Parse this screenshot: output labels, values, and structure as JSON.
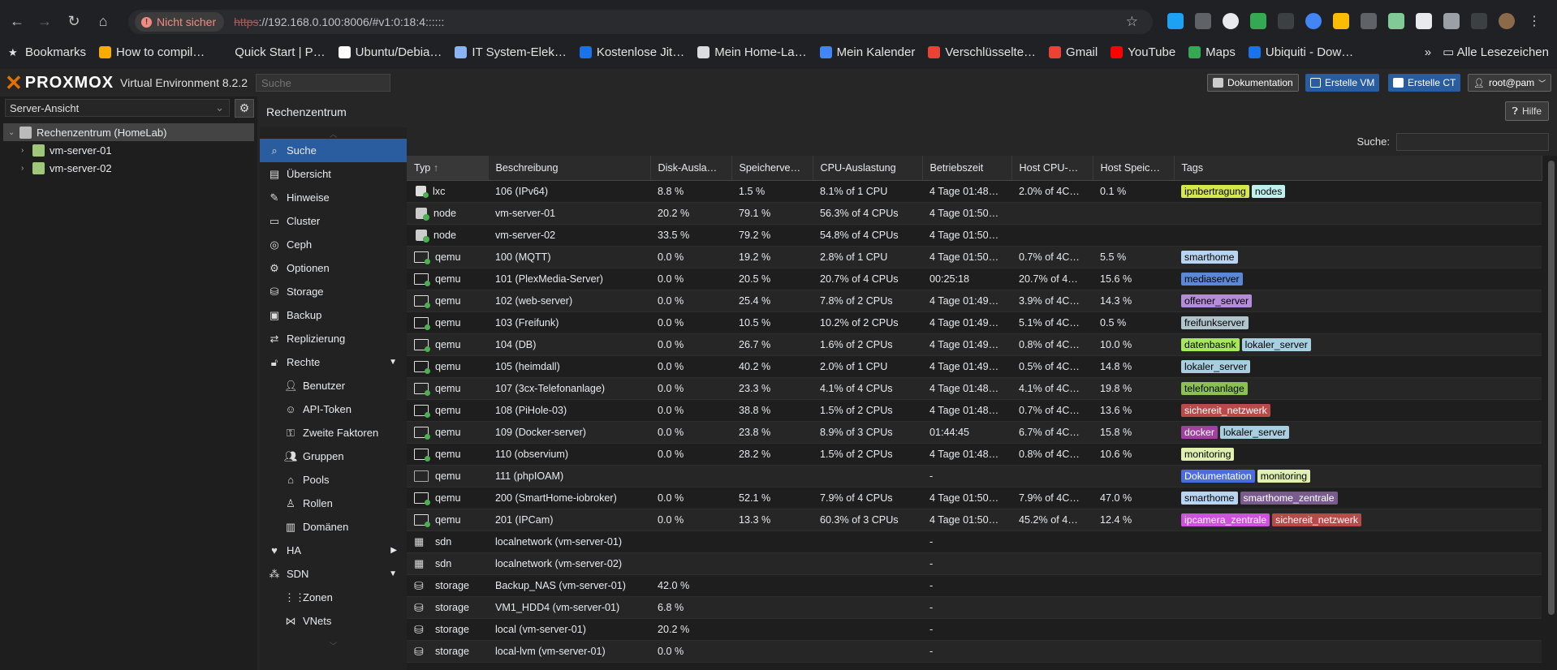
{
  "browser": {
    "not_secure_label": "Nicht sicher",
    "url_scheme": "https",
    "url_rest": "://192.168.0.100:8006/#v1:0:18:4::::::",
    "bookmarks": [
      {
        "label": "Bookmarks",
        "color": "#e3e3e3",
        "icon": "star-icon"
      },
      {
        "label": "How to compil…",
        "color": "#f9ab00",
        "icon": "bookmark-favicon"
      },
      {
        "label": "Quick Start | P…",
        "color": "#202124",
        "icon": "bookmark-favicon"
      },
      {
        "label": "Ubuntu/Debia…",
        "color": "#ffffff",
        "icon": "bookmark-favicon"
      },
      {
        "label": "IT System-Elek…",
        "color": "#8ab4f8",
        "icon": "bookmark-favicon"
      },
      {
        "label": "Kostenlose Jit…",
        "color": "#1a73e8",
        "icon": "bookmark-favicon"
      },
      {
        "label": "Mein Home-La…",
        "color": "#dadce0",
        "icon": "wordpress-icon"
      },
      {
        "label": "Mein Kalender",
        "color": "#4285f4",
        "icon": "calendar-icon"
      },
      {
        "label": "Verschlüsselte…",
        "color": "#ea4335",
        "icon": "bookmark-favicon"
      },
      {
        "label": "Gmail",
        "color": "#ea4335",
        "icon": "gmail-icon"
      },
      {
        "label": "YouTube",
        "color": "#ff0000",
        "icon": "youtube-icon"
      },
      {
        "label": "Maps",
        "color": "#34a853",
        "icon": "maps-icon"
      },
      {
        "label": "Ubiquiti - Dow…",
        "color": "#1a73e8",
        "icon": "bookmark-favicon"
      }
    ],
    "all_bookmarks_label": "Alle Lesezeichen"
  },
  "header": {
    "logo": "PROXMOX",
    "product": "Virtual Environment 8.2.2",
    "search_placeholder": "Suche",
    "btn_docs": "Dokumentation",
    "btn_create_vm": "Erstelle VM",
    "btn_create_ct": "Erstelle CT",
    "user": "root@pam"
  },
  "left": {
    "view_select": "Server-Ansicht",
    "tree": [
      {
        "label": "Rechenzentrum (HomeLab)",
        "level": 0
      },
      {
        "label": "vm-server-01",
        "level": 1
      },
      {
        "label": "vm-server-02",
        "level": 1
      }
    ]
  },
  "center": {
    "title": "Rechenzentrum",
    "help": "Hilfe",
    "search_label": "Suche:",
    "menu": [
      {
        "label": "Suche",
        "icon": "search-icon",
        "glyph": "⌕",
        "sub": false,
        "active": true
      },
      {
        "label": "Übersicht",
        "icon": "book-icon",
        "glyph": "▤",
        "sub": false
      },
      {
        "label": "Hinweise",
        "icon": "notes-icon",
        "glyph": "✎",
        "sub": false
      },
      {
        "label": "Cluster",
        "icon": "server-icon",
        "glyph": "▭",
        "sub": false
      },
      {
        "label": "Ceph",
        "icon": "ceph-icon",
        "glyph": "◎",
        "sub": false
      },
      {
        "label": "Optionen",
        "icon": "gear-icon",
        "glyph": "⚙",
        "sub": false
      },
      {
        "label": "Storage",
        "icon": "database-icon",
        "glyph": "⛁",
        "sub": false
      },
      {
        "label": "Backup",
        "icon": "floppy-icon",
        "glyph": "▣",
        "sub": false
      },
      {
        "label": "Replizierung",
        "icon": "retweet-icon",
        "glyph": "⇄",
        "sub": false
      },
      {
        "label": "Rechte",
        "icon": "unlock-icon",
        "glyph": "🔓︎",
        "sub": false,
        "caret": "down"
      },
      {
        "label": "Benutzer",
        "icon": "user-icon",
        "glyph": "👤︎",
        "sub": true
      },
      {
        "label": "API-Token",
        "icon": "user-outline-icon",
        "glyph": "☺",
        "sub": true
      },
      {
        "label": "Zweite Faktoren",
        "icon": "key-icon",
        "glyph": "⚿",
        "sub": true
      },
      {
        "label": "Gruppen",
        "icon": "users-icon",
        "glyph": "👥︎",
        "sub": true
      },
      {
        "label": "Pools",
        "icon": "tags-icon",
        "glyph": "⌂",
        "sub": true
      },
      {
        "label": "Rollen",
        "icon": "male-icon",
        "glyph": "♙",
        "sub": true
      },
      {
        "label": "Domänen",
        "icon": "address-book-icon",
        "glyph": "▥",
        "sub": true
      },
      {
        "label": "HA",
        "icon": "heartbeat-icon",
        "glyph": "♥",
        "sub": false,
        "caret": "right"
      },
      {
        "label": "SDN",
        "icon": "sdn-icon",
        "glyph": "⁂",
        "sub": false,
        "caret": "down"
      },
      {
        "label": "Zonen",
        "icon": "th-icon",
        "glyph": "⋮⋮",
        "sub": true
      },
      {
        "label": "VNets",
        "icon": "network-icon",
        "glyph": "⋈",
        "sub": true
      }
    ],
    "columns": [
      "Typ",
      "Beschreibung",
      "Disk-Ausla…",
      "Speicherve…",
      "CPU-Auslastung",
      "Betriebszeit",
      "Host CPU-…",
      "Host Speic…",
      "Tags"
    ],
    "rows": [
      {
        "type": "lxc",
        "desc": "106 (IPv64)",
        "disk": "8.8 %",
        "mem": "1.5 %",
        "cpu": "8.1% of 1 CPU",
        "uptime": "4 Tage 01:48…",
        "hcpu": "2.0% of 4C…",
        "hmem": "0.1 %",
        "tags": [
          {
            "t": "ipnbertragung",
            "c": "#d6e84b",
            "f": "#000"
          },
          {
            "t": "nodes",
            "c": "#c0f0ee",
            "f": "#000"
          }
        ]
      },
      {
        "type": "node",
        "desc": "vm-server-01",
        "disk": "20.2 %",
        "mem": "79.1 %",
        "cpu": "56.3% of 4 CPUs",
        "uptime": "4 Tage 01:50…",
        "hcpu": "",
        "hmem": "",
        "tags": []
      },
      {
        "type": "node",
        "desc": "vm-server-02",
        "disk": "33.5 %",
        "mem": "79.2 %",
        "cpu": "54.8% of 4 CPUs",
        "uptime": "4 Tage 01:50…",
        "hcpu": "",
        "hmem": "",
        "tags": []
      },
      {
        "type": "qemu",
        "desc": "100 (MQTT)",
        "disk": "0.0 %",
        "mem": "19.2 %",
        "cpu": "2.8% of 1 CPU",
        "uptime": "4 Tage 01:50…",
        "hcpu": "0.7% of 4C…",
        "hmem": "5.5 %",
        "tags": [
          {
            "t": "smarthome",
            "c": "#b8d4f0",
            "f": "#000"
          }
        ]
      },
      {
        "type": "qemu",
        "desc": "101 (PlexMedia-Server)",
        "disk": "0.0 %",
        "mem": "20.5 %",
        "cpu": "20.7% of 4 CPUs",
        "uptime": "00:25:18",
        "hcpu": "20.7% of 4…",
        "hmem": "15.6 %",
        "tags": [
          {
            "t": "mediaserver",
            "c": "#5a88d6",
            "f": "#000"
          }
        ]
      },
      {
        "type": "qemu",
        "desc": "102 (web-server)",
        "disk": "0.0 %",
        "mem": "25.4 %",
        "cpu": "7.8% of 2 CPUs",
        "uptime": "4 Tage 01:49…",
        "hcpu": "3.9% of 4C…",
        "hmem": "14.3 %",
        "tags": [
          {
            "t": "offener_server",
            "c": "#b48cd9",
            "f": "#000"
          }
        ]
      },
      {
        "type": "qemu",
        "desc": "103 (Freifunk)",
        "disk": "0.0 %",
        "mem": "10.5 %",
        "cpu": "10.2% of 2 CPUs",
        "uptime": "4 Tage 01:49…",
        "hcpu": "5.1% of 4C…",
        "hmem": "0.5 %",
        "tags": [
          {
            "t": "freifunkserver",
            "c": "#b0c4cc",
            "f": "#000"
          }
        ]
      },
      {
        "type": "qemu",
        "desc": "104 (DB)",
        "disk": "0.0 %",
        "mem": "26.7 %",
        "cpu": "1.6% of 2 CPUs",
        "uptime": "4 Tage 01:49…",
        "hcpu": "0.8% of 4C…",
        "hmem": "10.0 %",
        "tags": [
          {
            "t": "datenbasnk",
            "c": "#a6e85a",
            "f": "#000"
          },
          {
            "t": "lokaler_server",
            "c": "#a8cfe0",
            "f": "#000"
          }
        ]
      },
      {
        "type": "qemu",
        "desc": "105 (heimdall)",
        "disk": "0.0 %",
        "mem": "40.2 %",
        "cpu": "2.0% of 1 CPU",
        "uptime": "4 Tage 01:49…",
        "hcpu": "0.5% of 4C…",
        "hmem": "14.8 %",
        "tags": [
          {
            "t": "lokaler_server",
            "c": "#a8cfe0",
            "f": "#000"
          }
        ]
      },
      {
        "type": "qemu",
        "desc": "107 (3cx-Telefonanlage)",
        "disk": "0.0 %",
        "mem": "23.3 %",
        "cpu": "4.1% of 4 CPUs",
        "uptime": "4 Tage 01:48…",
        "hcpu": "4.1% of 4C…",
        "hmem": "19.8 %",
        "tags": [
          {
            "t": "telefonanlage",
            "c": "#8cc050",
            "f": "#000"
          }
        ]
      },
      {
        "type": "qemu",
        "desc": "108 (PiHole-03)",
        "disk": "0.0 %",
        "mem": "38.8 %",
        "cpu": "1.5% of 2 CPUs",
        "uptime": "4 Tage 01:48…",
        "hcpu": "0.7% of 4C…",
        "hmem": "13.6 %",
        "tags": [
          {
            "t": "sichereit_netzwerk",
            "c": "#b84a4a",
            "f": "#fff"
          }
        ]
      },
      {
        "type": "qemu",
        "desc": "109 (Docker-server)",
        "disk": "0.0 %",
        "mem": "23.8 %",
        "cpu": "8.9% of 3 CPUs",
        "uptime": "01:44:45",
        "hcpu": "6.7% of 4C…",
        "hmem": "15.8 %",
        "tags": [
          {
            "t": "docker",
            "c": "#a040a0",
            "f": "#fff"
          },
          {
            "t": "lokaler_server",
            "c": "#a8cfe0",
            "f": "#000"
          }
        ]
      },
      {
        "type": "qemu",
        "desc": "110 (observium)",
        "disk": "0.0 %",
        "mem": "28.2 %",
        "cpu": "1.5% of 2 CPUs",
        "uptime": "4 Tage 01:48…",
        "hcpu": "0.8% of 4C…",
        "hmem": "10.6 %",
        "tags": [
          {
            "t": "monitoring",
            "c": "#e0f0b0",
            "f": "#000"
          }
        ]
      },
      {
        "type": "qemu",
        "desc": "111 (phpIOAM)",
        "disk": "",
        "mem": "",
        "cpu": "",
        "uptime": "-",
        "hcpu": "",
        "hmem": "",
        "tags": [
          {
            "t": "Dokumentation",
            "c": "#4a6ee0",
            "f": "#fff"
          },
          {
            "t": "monitoring",
            "c": "#e0f0b0",
            "f": "#000"
          }
        ]
      },
      {
        "type": "qemu",
        "desc": "200 (SmartHome-iobroker)",
        "disk": "0.0 %",
        "mem": "52.1 %",
        "cpu": "7.9% of 4 CPUs",
        "uptime": "4 Tage 01:50…",
        "hcpu": "7.9% of 4C…",
        "hmem": "47.0 %",
        "tags": [
          {
            "t": "smarthome",
            "c": "#b8d4f0",
            "f": "#000"
          },
          {
            "t": "smarthome_zentrale",
            "c": "#7a5c8c",
            "f": "#fff"
          }
        ]
      },
      {
        "type": "qemu",
        "desc": "201 (IPCam)",
        "disk": "0.0 %",
        "mem": "13.3 %",
        "cpu": "60.3% of 3 CPUs",
        "uptime": "4 Tage 01:50…",
        "hcpu": "45.2% of 4…",
        "hmem": "12.4 %",
        "tags": [
          {
            "t": "ipcamera_zentrale",
            "c": "#d050e0",
            "f": "#fff"
          },
          {
            "t": "sichereit_netzwerk",
            "c": "#b84a4a",
            "f": "#fff"
          }
        ]
      },
      {
        "type": "sdn",
        "desc": "localnetwork (vm-server-01)",
        "disk": "",
        "mem": "",
        "cpu": "",
        "uptime": "-",
        "hcpu": "",
        "hmem": "",
        "tags": []
      },
      {
        "type": "sdn",
        "desc": "localnetwork (vm-server-02)",
        "disk": "",
        "mem": "",
        "cpu": "",
        "uptime": "-",
        "hcpu": "",
        "hmem": "",
        "tags": []
      },
      {
        "type": "storage",
        "desc": "Backup_NAS (vm-server-01)",
        "disk": "42.0 %",
        "mem": "",
        "cpu": "",
        "uptime": "-",
        "hcpu": "",
        "hmem": "",
        "tags": []
      },
      {
        "type": "storage",
        "desc": "VM1_HDD4 (vm-server-01)",
        "disk": "6.8 %",
        "mem": "",
        "cpu": "",
        "uptime": "-",
        "hcpu": "",
        "hmem": "",
        "tags": []
      },
      {
        "type": "storage",
        "desc": "local (vm-server-01)",
        "disk": "20.2 %",
        "mem": "",
        "cpu": "",
        "uptime": "-",
        "hcpu": "",
        "hmem": "",
        "tags": []
      },
      {
        "type": "storage",
        "desc": "local-lvm (vm-server-01)",
        "disk": "0.0 %",
        "mem": "",
        "cpu": "",
        "uptime": "-",
        "hcpu": "",
        "hmem": "",
        "tags": []
      }
    ]
  }
}
